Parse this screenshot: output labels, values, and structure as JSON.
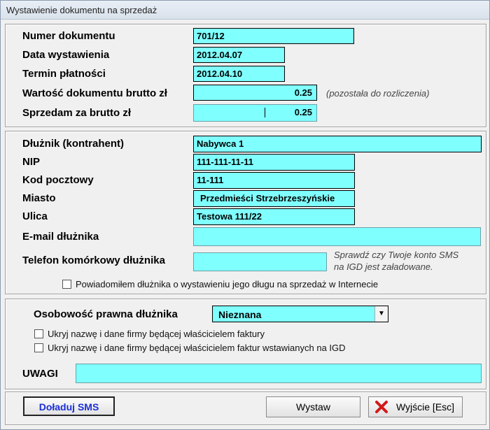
{
  "window": {
    "title": "Wystawienie dokumentu na sprzedaż"
  },
  "document": {
    "number_label": "Numer dokumentu",
    "number_value": "701/12",
    "date_label": "Data wystawienia",
    "date_value": "2012.04.07",
    "due_label": "Termin płatności",
    "due_value": "2012.04.10",
    "gross_label": "Wartość dokumentu brutto zł",
    "gross_value": "0.25",
    "gross_note": "(pozostała do rozliczenia)",
    "sell_label": "Sprzedam za brutto zł",
    "sell_value": "0.25"
  },
  "debtor": {
    "name_label": "Dłużnik (kontrahent)",
    "name_value": "Nabywca 1",
    "nip_label": "NIP",
    "nip_value": "111-111-11-11",
    "zip_label": "Kod pocztowy",
    "zip_value": "11-111",
    "city_label": "Miasto",
    "city_value": "Przedmieści Strzebrzeszyńskie",
    "street_label": "Ulica",
    "street_value": "Testowa 111/22",
    "email_label": "E-mail dłużnika",
    "email_value": "",
    "phone_label": "Telefon komórkowy dłużnika",
    "phone_value": "",
    "sms_note_line1": "Sprawdź czy Twoje konto SMS",
    "sms_note_line2": "na IGD jest załadowane.",
    "notify_label": "Powiadomiłem dłużnika o wystawieniu jego długu na sprzedaż w Internecie"
  },
  "legal": {
    "label": "Osobowość prawna dłużnika",
    "selected": "Nieznana",
    "hide_invoice_owner_label": "Ukryj nazwę i dane firmy będącej właścicielem faktury",
    "hide_invoices_owner_label": "Ukryj nazwę i dane firmy będącej właścicielem faktur wstawianych na IGD",
    "remarks_label": "UWAGI",
    "remarks_value": ""
  },
  "buttons": {
    "topup_sms": "Doładuj SMS",
    "submit": "Wystaw",
    "exit": "Wyjście  [Esc]"
  }
}
